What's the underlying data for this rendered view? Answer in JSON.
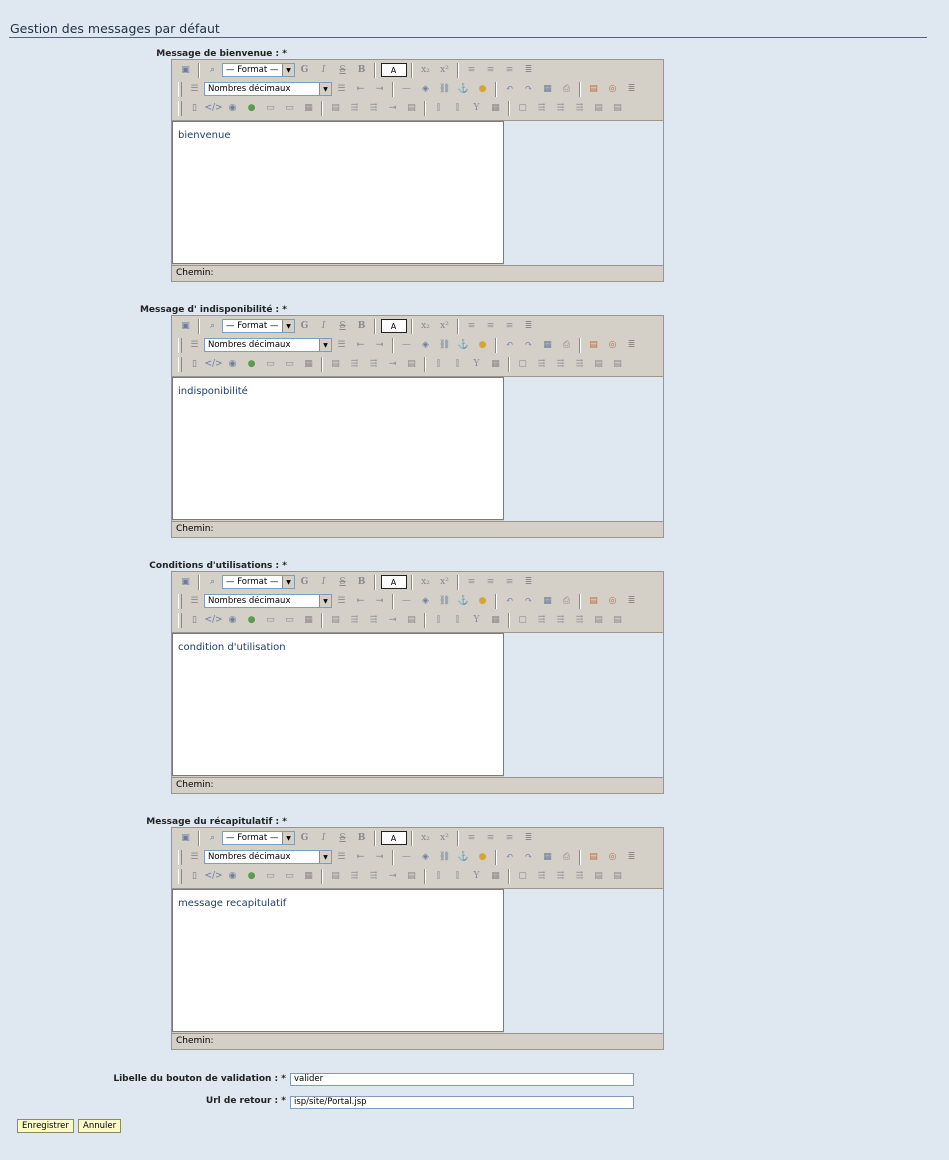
{
  "page": {
    "title": "Gestion des messages par défaut"
  },
  "editors": [
    {
      "label": "Message de bienvenue : *",
      "content": "bienvenue"
    },
    {
      "label": "Message d' indisponibilité : *",
      "content": "indisponibilité"
    },
    {
      "label": "Conditions d'utilisations : *",
      "content": "condition d'utilisation"
    },
    {
      "label": "Message du récapitulatif : *",
      "content": "message recapitulatif"
    }
  ],
  "toolbar": {
    "format_select": "— Format —",
    "list_select": "Nombres décimaux",
    "bold_g": "G",
    "italic": "I",
    "strike": "S",
    "bold_b": "B",
    "font_color": "A",
    "path_label": "Chemin:"
  },
  "fields": {
    "validation_label": "Libelle du bouton de validation : *",
    "validation_value": "valider",
    "return_label": "Url de retour : *",
    "return_value": "isp/site/Portal.jsp"
  },
  "buttons": {
    "save": "Enregistrer",
    "cancel": "Annuler"
  }
}
